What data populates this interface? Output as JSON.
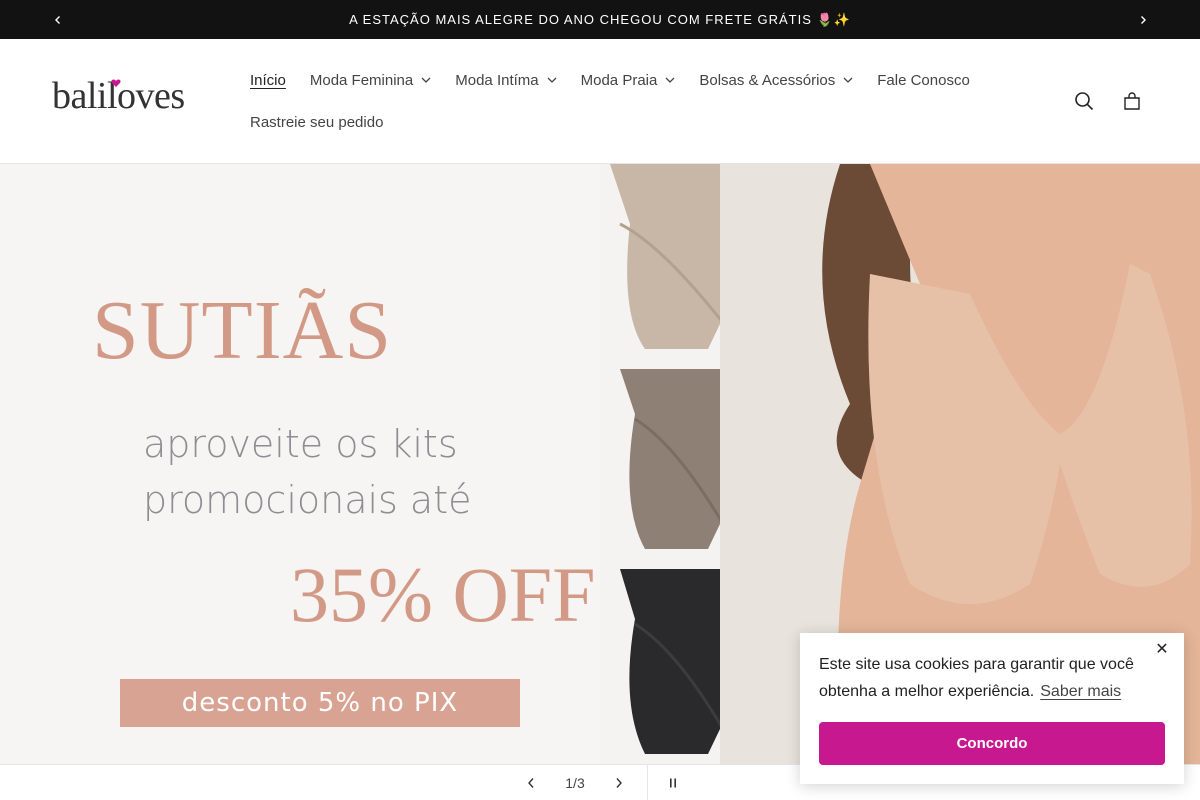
{
  "announcement": {
    "text": "A ESTAÇÃO MAIS ALEGRE DO ANO CHEGOU COM FRETE GRÁTIS 🌷✨",
    "prev_icon": "chevron-left-icon",
    "next_icon": "chevron-right-icon"
  },
  "header": {
    "logo_text": "baliloves",
    "nav": [
      {
        "label": "Início",
        "active": true
      },
      {
        "label": "Moda Feminina",
        "dropdown": true
      },
      {
        "label": "Moda Intíma",
        "dropdown": true
      },
      {
        "label": "Moda Praia",
        "dropdown": true
      },
      {
        "label": "Bolsas & Acessórios",
        "dropdown": true
      },
      {
        "label": "Fale Conosco"
      },
      {
        "label": "Rastreie seu pedido"
      }
    ],
    "icons": [
      "search-icon",
      "cart-icon"
    ]
  },
  "hero": {
    "title": "SUTIÃS",
    "subtitle_line1": "aproveite os kits",
    "subtitle_line2": "promocionais até",
    "discount": "35% OFF",
    "pix": "desconto 5% no PIX",
    "accent_color": "#d29a86"
  },
  "slider": {
    "counter": "1/3",
    "prev_icon": "chevron-left-icon",
    "next_icon": "chevron-right-icon",
    "pause_icon": "pause-icon"
  },
  "cookie": {
    "text": "Este site usa cookies para garantir que você obtenha a melhor experiência.",
    "link": "Saber mais",
    "button": "Concordo",
    "close": "✕",
    "button_color": "#c8188f"
  }
}
